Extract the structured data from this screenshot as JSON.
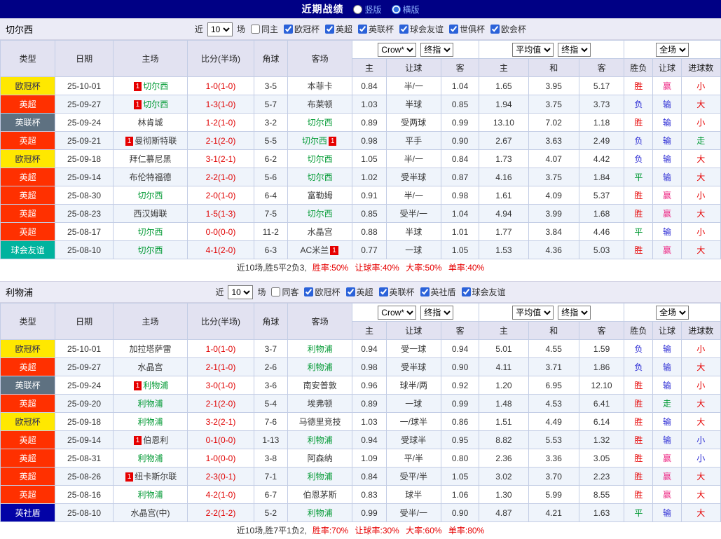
{
  "top_bar": {
    "title": "近期战绩",
    "options": [
      {
        "label": "竖版",
        "selected": false
      },
      {
        "label": "横版",
        "selected": true
      }
    ]
  },
  "result_colors": {
    "red": "#e60000",
    "blue": "#2a2ad4",
    "green": "#009933",
    "pink": "#ee2d87"
  },
  "league_styles": {
    "欧冠杯": {
      "bg": "#ffe800",
      "fg": "#222255"
    },
    "英超": {
      "bg": "#ff3000",
      "fg": "#ffffff"
    },
    "英联杯": {
      "bg": "#5e7181",
      "fg": "#ffffff"
    },
    "球会友谊": {
      "bg": "#00b39e",
      "fg": "#ffffff"
    },
    "英社盾": {
      "bg": "#0202a6",
      "fg": "#ffffff"
    }
  },
  "sections": [
    {
      "team": "切尔西",
      "filter": {
        "near": "近",
        "count": "10",
        "games": "场",
        "venue": {
          "label": "同主",
          "checked": false
        },
        "leagues": [
          {
            "label": "欧冠杯",
            "checked": true
          },
          {
            "label": "英超",
            "checked": true
          },
          {
            "label": "英联杯",
            "checked": true
          },
          {
            "label": "球会友谊",
            "checked": true
          },
          {
            "label": "世俱杯",
            "checked": true
          },
          {
            "label": "欧会杯",
            "checked": true
          }
        ]
      },
      "selects": {
        "ah_source": "Crow*",
        "ah_time": "终指",
        "eu_source": "平均值",
        "eu_time": "终指",
        "scope": "全场"
      },
      "columns": [
        "类型",
        "日期",
        "主场",
        "比分(半场)",
        "角球",
        "客场",
        "主",
        "让球",
        "客",
        "主",
        "和",
        "客",
        "胜负",
        "让球",
        "进球数"
      ],
      "rows": [
        {
          "league": "欧冠杯",
          "date": "25-10-01",
          "home": {
            "name": "切尔西",
            "focus": true,
            "badge": "1",
            "badge_pos": "before"
          },
          "score": "1-0(1-0)",
          "corners": "3-5",
          "away": {
            "name": "本菲卡"
          },
          "ah": [
            "0.84",
            "半/一",
            "1.04"
          ],
          "eu": [
            "1.65",
            "3.95",
            "5.17"
          ],
          "res": [
            [
              "胜",
              "red"
            ],
            [
              "赢",
              "pink"
            ],
            [
              "小",
              "red"
            ]
          ]
        },
        {
          "league": "英超",
          "date": "25-09-27",
          "home": {
            "name": "切尔西",
            "focus": true,
            "badge": "1",
            "badge_pos": "before"
          },
          "score": "1-3(1-0)",
          "corners": "5-7",
          "away": {
            "name": "布莱顿"
          },
          "ah": [
            "1.03",
            "半球",
            "0.85"
          ],
          "eu": [
            "1.94",
            "3.75",
            "3.73"
          ],
          "res": [
            [
              "负",
              "blue"
            ],
            [
              "输",
              "blue"
            ],
            [
              "大",
              "red"
            ]
          ]
        },
        {
          "league": "英联杯",
          "date": "25-09-24",
          "home": {
            "name": "林肯城"
          },
          "score": "1-2(1-0)",
          "corners": "3-2",
          "away": {
            "name": "切尔西",
            "focus": true
          },
          "ah": [
            "0.89",
            "受两球",
            "0.99"
          ],
          "eu": [
            "13.10",
            "7.02",
            "1.18"
          ],
          "res": [
            [
              "胜",
              "red"
            ],
            [
              "输",
              "blue"
            ],
            [
              "小",
              "red"
            ]
          ]
        },
        {
          "league": "英超",
          "date": "25-09-21",
          "home": {
            "name": "曼彻斯特联",
            "badge": "1",
            "badge_pos": "before"
          },
          "score": "2-1(2-0)",
          "corners": "5-5",
          "away": {
            "name": "切尔西",
            "focus": true,
            "badge": "1",
            "badge_pos": "after"
          },
          "ah": [
            "0.98",
            "平手",
            "0.90"
          ],
          "eu": [
            "2.67",
            "3.63",
            "2.49"
          ],
          "res": [
            [
              "负",
              "blue"
            ],
            [
              "输",
              "blue"
            ],
            [
              "走",
              "green"
            ]
          ]
        },
        {
          "league": "欧冠杯",
          "date": "25-09-18",
          "home": {
            "name": "拜仁慕尼黑"
          },
          "score": "3-1(2-1)",
          "corners": "6-2",
          "away": {
            "name": "切尔西",
            "focus": true
          },
          "ah": [
            "1.05",
            "半/一",
            "0.84"
          ],
          "eu": [
            "1.73",
            "4.07",
            "4.42"
          ],
          "res": [
            [
              "负",
              "blue"
            ],
            [
              "输",
              "blue"
            ],
            [
              "大",
              "red"
            ]
          ]
        },
        {
          "league": "英超",
          "date": "25-09-14",
          "home": {
            "name": "布伦特福德"
          },
          "score": "2-2(1-0)",
          "corners": "5-6",
          "away": {
            "name": "切尔西",
            "focus": true
          },
          "ah": [
            "1.02",
            "受半球",
            "0.87"
          ],
          "eu": [
            "4.16",
            "3.75",
            "1.84"
          ],
          "res": [
            [
              "平",
              "green"
            ],
            [
              "输",
              "blue"
            ],
            [
              "大",
              "red"
            ]
          ]
        },
        {
          "league": "英超",
          "date": "25-08-30",
          "home": {
            "name": "切尔西",
            "focus": true
          },
          "score": "2-0(1-0)",
          "corners": "6-4",
          "away": {
            "name": "富勒姆"
          },
          "ah": [
            "0.91",
            "半/一",
            "0.98"
          ],
          "eu": [
            "1.61",
            "4.09",
            "5.37"
          ],
          "res": [
            [
              "胜",
              "red"
            ],
            [
              "赢",
              "pink"
            ],
            [
              "小",
              "red"
            ]
          ]
        },
        {
          "league": "英超",
          "date": "25-08-23",
          "home": {
            "name": "西汉姆联"
          },
          "score": "1-5(1-3)",
          "corners": "7-5",
          "away": {
            "name": "切尔西",
            "focus": true
          },
          "ah": [
            "0.85",
            "受半/一",
            "1.04"
          ],
          "eu": [
            "4.94",
            "3.99",
            "1.68"
          ],
          "res": [
            [
              "胜",
              "red"
            ],
            [
              "赢",
              "pink"
            ],
            [
              "大",
              "red"
            ]
          ]
        },
        {
          "league": "英超",
          "date": "25-08-17",
          "home": {
            "name": "切尔西",
            "focus": true
          },
          "score": "0-0(0-0)",
          "corners": "11-2",
          "away": {
            "name": "水晶宫"
          },
          "ah": [
            "0.88",
            "半球",
            "1.01"
          ],
          "eu": [
            "1.77",
            "3.84",
            "4.46"
          ],
          "res": [
            [
              "平",
              "green"
            ],
            [
              "输",
              "blue"
            ],
            [
              "小",
              "red"
            ]
          ]
        },
        {
          "league": "球会友谊",
          "date": "25-08-10",
          "home": {
            "name": "切尔西",
            "focus": true
          },
          "score": "4-1(2-0)",
          "corners": "6-3",
          "away": {
            "name": "AC米兰",
            "badge": "1",
            "badge_pos": "after"
          },
          "ah": [
            "0.77",
            "一球",
            "1.05"
          ],
          "eu": [
            "1.53",
            "4.36",
            "5.03"
          ],
          "res": [
            [
              "胜",
              "red"
            ],
            [
              "赢",
              "pink"
            ],
            [
              "大",
              "red"
            ]
          ]
        }
      ],
      "summary": {
        "prefix": "近10场,胜5平2负3,",
        "stats": "胜率:50% 让球率:40% 大率:50% 单率:40%"
      }
    },
    {
      "team": "利物浦",
      "filter": {
        "near": "近",
        "count": "10",
        "games": "场",
        "venue": {
          "label": "同客",
          "checked": false
        },
        "leagues": [
          {
            "label": "欧冠杯",
            "checked": true
          },
          {
            "label": "英超",
            "checked": true
          },
          {
            "label": "英联杯",
            "checked": true
          },
          {
            "label": "英社盾",
            "checked": true
          },
          {
            "label": "球会友谊",
            "checked": true
          }
        ]
      },
      "selects": {
        "ah_source": "Crow*",
        "ah_time": "终指",
        "eu_source": "平均值",
        "eu_time": "终指",
        "scope": "全场"
      },
      "columns": [
        "类型",
        "日期",
        "主场",
        "比分(半场)",
        "角球",
        "客场",
        "主",
        "让球",
        "客",
        "主",
        "和",
        "客",
        "胜负",
        "让球",
        "进球数"
      ],
      "rows": [
        {
          "league": "欧冠杯",
          "date": "25-10-01",
          "home": {
            "name": "加拉塔萨雷"
          },
          "score": "1-0(1-0)",
          "corners": "3-7",
          "away": {
            "name": "利物浦",
            "focus": true
          },
          "ah": [
            "0.94",
            "受一球",
            "0.94"
          ],
          "eu": [
            "5.01",
            "4.55",
            "1.59"
          ],
          "res": [
            [
              "负",
              "blue"
            ],
            [
              "输",
              "blue"
            ],
            [
              "小",
              "red"
            ]
          ]
        },
        {
          "league": "英超",
          "date": "25-09-27",
          "home": {
            "name": "水晶宫"
          },
          "score": "2-1(1-0)",
          "corners": "2-6",
          "away": {
            "name": "利物浦",
            "focus": true
          },
          "ah": [
            "0.98",
            "受半球",
            "0.90"
          ],
          "eu": [
            "4.11",
            "3.71",
            "1.86"
          ],
          "res": [
            [
              "负",
              "blue"
            ],
            [
              "输",
              "blue"
            ],
            [
              "大",
              "red"
            ]
          ]
        },
        {
          "league": "英联杯",
          "date": "25-09-24",
          "home": {
            "name": "利物浦",
            "focus": true,
            "badge": "1",
            "badge_pos": "before"
          },
          "score": "3-0(1-0)",
          "corners": "3-6",
          "away": {
            "name": "南安普敦"
          },
          "ah": [
            "0.96",
            "球半/两",
            "0.92"
          ],
          "eu": [
            "1.20",
            "6.95",
            "12.10"
          ],
          "res": [
            [
              "胜",
              "red"
            ],
            [
              "输",
              "blue"
            ],
            [
              "小",
              "red"
            ]
          ]
        },
        {
          "league": "英超",
          "date": "25-09-20",
          "home": {
            "name": "利物浦",
            "focus": true
          },
          "score": "2-1(2-0)",
          "corners": "5-4",
          "away": {
            "name": "埃弗顿"
          },
          "ah": [
            "0.89",
            "一球",
            "0.99"
          ],
          "eu": [
            "1.48",
            "4.53",
            "6.41"
          ],
          "res": [
            [
              "胜",
              "red"
            ],
            [
              "走",
              "green"
            ],
            [
              "大",
              "red"
            ]
          ]
        },
        {
          "league": "欧冠杯",
          "date": "25-09-18",
          "home": {
            "name": "利物浦",
            "focus": true
          },
          "score": "3-2(2-1)",
          "corners": "7-6",
          "away": {
            "name": "马德里竞技"
          },
          "ah": [
            "1.03",
            "一/球半",
            "0.86"
          ],
          "eu": [
            "1.51",
            "4.49",
            "6.14"
          ],
          "res": [
            [
              "胜",
              "red"
            ],
            [
              "输",
              "blue"
            ],
            [
              "大",
              "red"
            ]
          ]
        },
        {
          "league": "英超",
          "date": "25-09-14",
          "home": {
            "name": "伯恩利",
            "badge": "1",
            "badge_pos": "before"
          },
          "score": "0-1(0-0)",
          "corners": "1-13",
          "away": {
            "name": "利物浦",
            "focus": true
          },
          "ah": [
            "0.94",
            "受球半",
            "0.95"
          ],
          "eu": [
            "8.82",
            "5.53",
            "1.32"
          ],
          "res": [
            [
              "胜",
              "red"
            ],
            [
              "输",
              "blue"
            ],
            [
              "小",
              "blue"
            ]
          ]
        },
        {
          "league": "英超",
          "date": "25-08-31",
          "home": {
            "name": "利物浦",
            "focus": true
          },
          "score": "1-0(0-0)",
          "corners": "3-8",
          "away": {
            "name": "阿森纳"
          },
          "ah": [
            "1.09",
            "平/半",
            "0.80"
          ],
          "eu": [
            "2.36",
            "3.36",
            "3.05"
          ],
          "res": [
            [
              "胜",
              "red"
            ],
            [
              "赢",
              "pink"
            ],
            [
              "小",
              "blue"
            ]
          ]
        },
        {
          "league": "英超",
          "date": "25-08-26",
          "home": {
            "name": "纽卡斯尔联",
            "badge": "1",
            "badge_pos": "before"
          },
          "score": "2-3(0-1)",
          "corners": "7-1",
          "away": {
            "name": "利物浦",
            "focus": true
          },
          "ah": [
            "0.84",
            "受平/半",
            "1.05"
          ],
          "eu": [
            "3.02",
            "3.70",
            "2.23"
          ],
          "res": [
            [
              "胜",
              "red"
            ],
            [
              "赢",
              "pink"
            ],
            [
              "大",
              "red"
            ]
          ]
        },
        {
          "league": "英超",
          "date": "25-08-16",
          "home": {
            "name": "利物浦",
            "focus": true
          },
          "score": "4-2(1-0)",
          "corners": "6-7",
          "away": {
            "name": "伯恩茅斯"
          },
          "ah": [
            "0.83",
            "球半",
            "1.06"
          ],
          "eu": [
            "1.30",
            "5.99",
            "8.55"
          ],
          "res": [
            [
              "胜",
              "red"
            ],
            [
              "赢",
              "pink"
            ],
            [
              "大",
              "red"
            ]
          ]
        },
        {
          "league": "英社盾",
          "date": "25-08-10",
          "home": {
            "name": "水晶宫(中)"
          },
          "score": "2-2(1-2)",
          "corners": "5-2",
          "away": {
            "name": "利物浦",
            "focus": true
          },
          "ah": [
            "0.99",
            "受半/一",
            "0.90"
          ],
          "eu": [
            "4.87",
            "4.21",
            "1.63"
          ],
          "res": [
            [
              "平",
              "green"
            ],
            [
              "输",
              "blue"
            ],
            [
              "大",
              "red"
            ]
          ]
        }
      ],
      "summary": {
        "prefix": "近10场,胜7平1负2,",
        "stats": "胜率:70% 让球率:30% 大率:60% 单率:80%"
      }
    }
  ]
}
